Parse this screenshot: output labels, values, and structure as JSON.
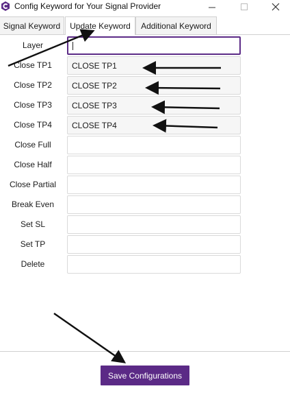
{
  "window": {
    "title": "Config Keyword for Your Signal Provider",
    "minimize_icon": "minimize-icon",
    "maximize_icon": "maximize-icon",
    "close_icon": "close-icon",
    "app_icon": "app-logo-icon"
  },
  "tabs": [
    {
      "label": "Signal Keyword",
      "active": false
    },
    {
      "label": "Update Keyword",
      "active": true
    },
    {
      "label": "Additional Keyword",
      "active": false
    }
  ],
  "form": {
    "rows": [
      {
        "label": "Layer",
        "value": "",
        "focused": true
      },
      {
        "label": "Close TP1",
        "value": "CLOSE TP1"
      },
      {
        "label": "Close TP2",
        "value": "CLOSE TP2"
      },
      {
        "label": "Close TP3",
        "value": "CLOSE TP3"
      },
      {
        "label": "Close TP4",
        "value": "CLOSE TP4"
      },
      {
        "label": "Close Full",
        "value": ""
      },
      {
        "label": "Close Half",
        "value": ""
      },
      {
        "label": "Close Partial",
        "value": ""
      },
      {
        "label": "Break Even",
        "value": ""
      },
      {
        "label": "Set SL",
        "value": ""
      },
      {
        "label": "Set TP",
        "value": ""
      },
      {
        "label": "Delete",
        "value": ""
      }
    ]
  },
  "footer": {
    "save_label": "Save Configurations"
  },
  "colors": {
    "accent": "#5b2a86",
    "annotation_arrow": "#111111"
  }
}
